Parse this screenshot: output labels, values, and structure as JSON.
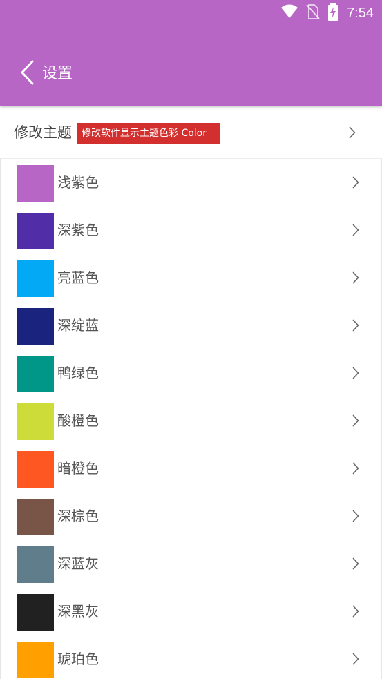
{
  "status_bar": {
    "time": "7:54",
    "icons": [
      "wifi-icon",
      "no-sim-icon",
      "battery-charging-icon"
    ]
  },
  "toolbar": {
    "back_icon": "chevron-left-icon",
    "title": "设置"
  },
  "theme_row": {
    "label": "修改主题",
    "badge": "修改软件显示主题色彩 Color"
  },
  "colors": [
    {
      "name": "浅紫色",
      "hex": "#b766c6"
    },
    {
      "name": "深紫色",
      "hex": "#512da8"
    },
    {
      "name": "亮蓝色",
      "hex": "#03a9f4"
    },
    {
      "name": "深绽蓝",
      "hex": "#1a237e"
    },
    {
      "name": "鸭绿色",
      "hex": "#009688"
    },
    {
      "name": "酸橙色",
      "hex": "#cddc39"
    },
    {
      "name": "暗橙色",
      "hex": "#ff5722"
    },
    {
      "name": "深棕色",
      "hex": "#795548"
    },
    {
      "name": "深蓝灰",
      "hex": "#607d8b"
    },
    {
      "name": "深黑灰",
      "hex": "#212121"
    },
    {
      "name": "琥珀色",
      "hex": "#ffa000"
    }
  ]
}
